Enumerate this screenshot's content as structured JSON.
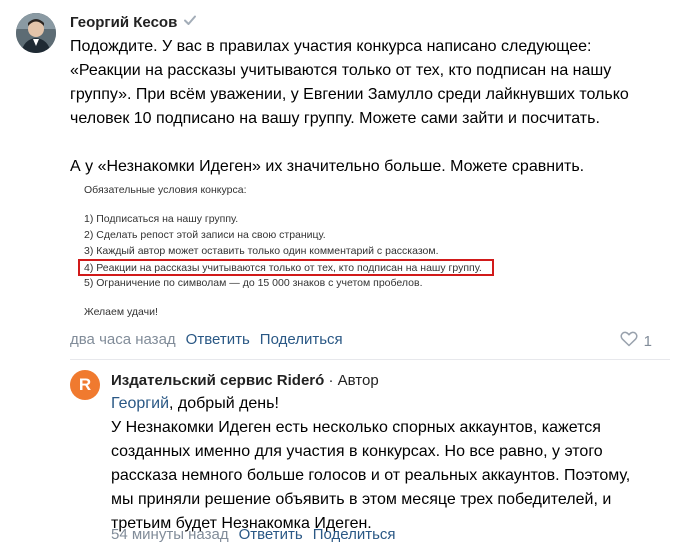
{
  "comment": {
    "author": "Георгий Кесов",
    "lines": [
      "Подождите. У вас в правилах участия конкурса написано следующее:",
      "«Реакции на рассказы учитываются только от тех, кто подписан на нашу",
      "группу». При всём уважении, у Евгении Замулло среди лайкнувших только",
      "человек 10 подписано на вашу группу. Можете сами зайти и посчитать.",
      "А у «Незнакомки Идеген» их значительно больше. Можете сравнить."
    ],
    "attachment": {
      "heading": "Обязательные условия конкурса:",
      "items": [
        "1) Подписаться на нашу группу.",
        "2) Сделать репост этой записи на свою страницу.",
        "3) Каждый автор может оставить только один комментарий с рассказом.",
        "4) Реакции на рассказы учитываются только от тех, кто подписан на нашу группу.",
        "5) Ограничение по символам — до 15 000 знаков с учетом пробелов."
      ],
      "footer": "Желаем удачи!"
    },
    "time": "два часа назад",
    "reply_label": "Ответить",
    "share_label": "Поделиться",
    "likes": "1"
  },
  "reply": {
    "avatar_letter": "R",
    "author": "Издательский сервис Rideró",
    "author_suffix": " · Автор",
    "mention": "Георгий",
    "first_line_rest": ", добрый день!",
    "lines": [
      "У Незнакомки Идеген есть несколько спорных аккаунтов, кажется",
      "созданных именно для участия в конкурсах. Но все равно, у этого",
      "рассказа немного больше голосов и от реальных аккаунтов. Поэтому,",
      "мы приняли решение объявить в этом месяце трех победителей, и",
      "третьим будет Незнакомка Идеген."
    ],
    "time": "54 минуты назад",
    "reply_label": "Ответить",
    "share_label": "Поделиться"
  },
  "colors": {
    "link": "#2a5885",
    "meta": "#818c99",
    "highlight": "#d11a1a",
    "avatar_reply": "#f07a2f"
  }
}
